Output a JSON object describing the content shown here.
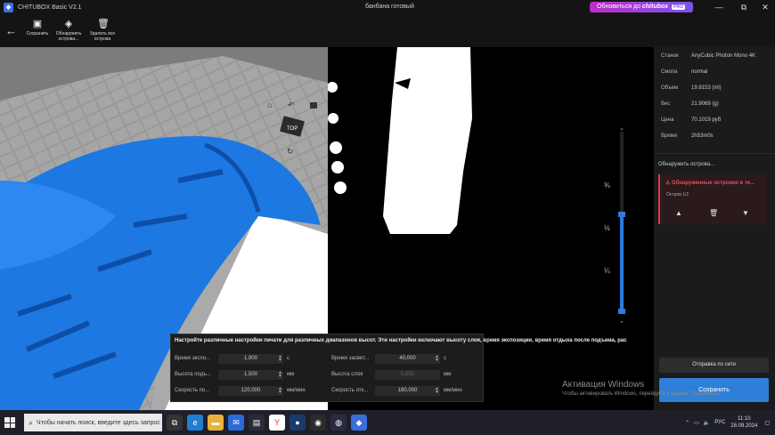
{
  "titlebar": {
    "app_title": "CHITUBOX Basic V2.1",
    "document_title": "банбана готовый",
    "upgrade_prefix": "Обновиться до",
    "upgrade_brand": "chitubox",
    "upgrade_tag": "PRO"
  },
  "toolbar": {
    "save_label": "Сохранить",
    "detect_label": "Обнаружить острова...",
    "delete_label": "Удалить все острова"
  },
  "slice_slider": {
    "labels": [
      "¾",
      "½",
      "¼"
    ]
  },
  "printer_info": {
    "rows": [
      {
        "label": "Станок",
        "value": "AnyCubic Photon Mono 4K"
      },
      {
        "label": "Смола",
        "value": "normal"
      },
      {
        "label": "Объем",
        "value": "19.9153 (ml)"
      },
      {
        "label": "Вес",
        "value": "21.9069 (g)"
      },
      {
        "label": "Цена",
        "value": "70.1019 руб"
      },
      {
        "label": "Время",
        "value": "2h53m0s"
      }
    ]
  },
  "islands": {
    "title": "Обнаружить острова...",
    "warning": "Обнаруженные островки в те...",
    "item": "Остров 1/1"
  },
  "actions": {
    "network_send": "Отправка по сети",
    "save": "Сохранить"
  },
  "settings_panel": {
    "header": "Настройте различные настройки печати для различных диапазонов высот. Эти настройки включают высоту слоя, время экспозиции, время отдыха после подъема, рас",
    "left": [
      {
        "label": "Время экспо...",
        "value": "1,900",
        "unit": "с"
      },
      {
        "label": "Высота подъ...",
        "value": "1,500",
        "unit": "мм"
      },
      {
        "label": "Скорость по...",
        "value": "120,000",
        "unit": "мм/мин"
      }
    ],
    "right": [
      {
        "label": "Время засвет...",
        "value": "40,000",
        "unit": "с"
      },
      {
        "label": "Высота слоя",
        "value": "0,050",
        "unit": "мм"
      },
      {
        "label": "Скорость отк...",
        "value": "180,000",
        "unit": "мм/мин"
      }
    ]
  },
  "watermark": {
    "line1": "Активация Windows",
    "line2": "Чтобы активировать Windows, перейдите в раздел \"Параметры\"."
  },
  "taskbar": {
    "search_placeholder": "Чтобы начать поиск, введите здесь запрос",
    "lang": "РУС",
    "time": "11:10",
    "date": "28.09.2024"
  },
  "colors": {
    "accent": "#2e7fd8",
    "model": "#1f78e0",
    "warning": "#d63a4a",
    "upgrade_gradient_start": "#c02cc9",
    "upgrade_gradient_end": "#7a55e8"
  }
}
